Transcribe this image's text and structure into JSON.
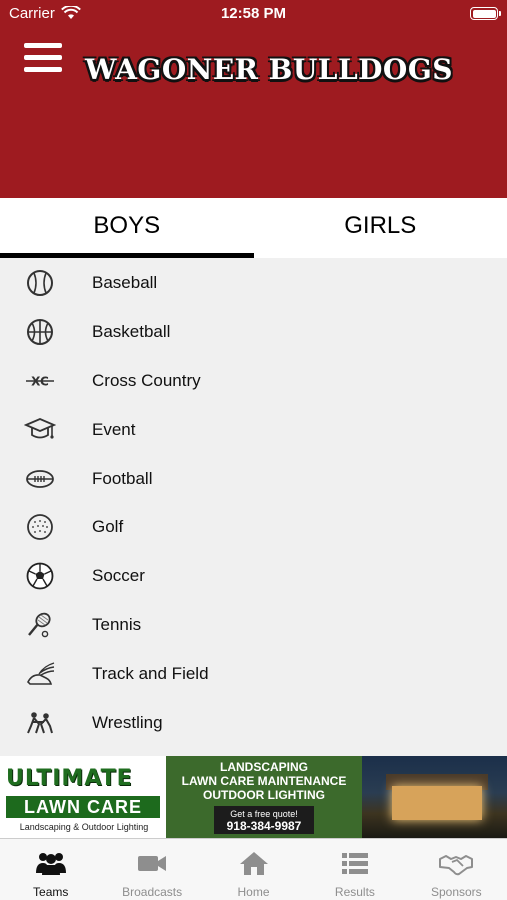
{
  "status_bar": {
    "carrier": "Carrier",
    "time": "12:58 PM"
  },
  "header": {
    "title": "WAGONER BULLDOGS",
    "color": "#9e1b20"
  },
  "tabs": [
    {
      "label": "BOYS",
      "active": true
    },
    {
      "label": "GIRLS",
      "active": false
    }
  ],
  "sports": [
    {
      "label": "Baseball",
      "icon": "baseball-icon"
    },
    {
      "label": "Basketball",
      "icon": "basketball-icon"
    },
    {
      "label": "Cross Country",
      "icon": "cross-country-icon"
    },
    {
      "label": "Event",
      "icon": "graduation-cap-icon"
    },
    {
      "label": "Football",
      "icon": "football-icon"
    },
    {
      "label": "Golf",
      "icon": "golf-ball-icon"
    },
    {
      "label": "Soccer",
      "icon": "soccer-ball-icon"
    },
    {
      "label": "Tennis",
      "icon": "tennis-racket-icon"
    },
    {
      "label": "Track and Field",
      "icon": "winged-shoe-icon"
    },
    {
      "label": "Wrestling",
      "icon": "wrestling-icon"
    }
  ],
  "ad": {
    "logo_line1": "ULTIMATE",
    "logo_line2": "LAWN CARE",
    "logo_line3": "Landscaping & Outdoor Lighting",
    "services": "LANDSCAPING\nLAWN CARE MAINTENANCE\nOUTDOOR LIGHTING",
    "cta": "Get a free quote!",
    "phone": "918-384-9987"
  },
  "tabbar": [
    {
      "label": "Teams",
      "icon": "teams-icon",
      "active": true
    },
    {
      "label": "Broadcasts",
      "icon": "video-camera-icon",
      "active": false
    },
    {
      "label": "Home",
      "icon": "home-icon",
      "active": false
    },
    {
      "label": "Results",
      "icon": "list-icon",
      "active": false
    },
    {
      "label": "Sponsors",
      "icon": "handshake-icon",
      "active": false
    }
  ]
}
